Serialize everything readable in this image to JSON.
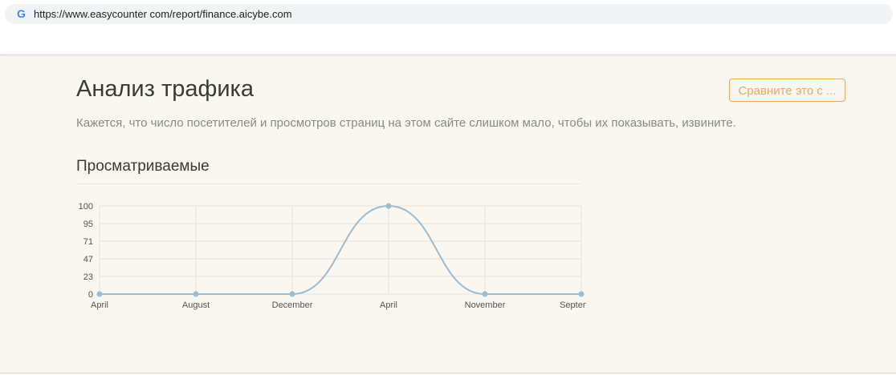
{
  "browser": {
    "url": "https://www.easycounter com/report/finance.aicybe.com",
    "favicon": "G"
  },
  "page": {
    "title": "Анализ трафика",
    "compare_button": "Сравните это с ...",
    "description": "Кажется, что число посетителей и просмотров страниц на этом сайте слишком мало, чтобы их показывать, извините.",
    "section_title": "Просматриваемые"
  },
  "colors": {
    "accent": "#f0a866",
    "line": "#9dbcd0",
    "point": "#9dbcd0"
  },
  "chart_data": {
    "type": "line",
    "categories": [
      "April",
      "August",
      "December",
      "April",
      "November",
      "September"
    ],
    "series": [
      {
        "values": [
          0,
          0,
          0,
          100,
          0,
          0
        ]
      }
    ],
    "y_ticks": [
      0,
      23,
      47,
      71,
      95,
      100
    ],
    "ylim": [
      0,
      100
    ],
    "grid": true
  }
}
